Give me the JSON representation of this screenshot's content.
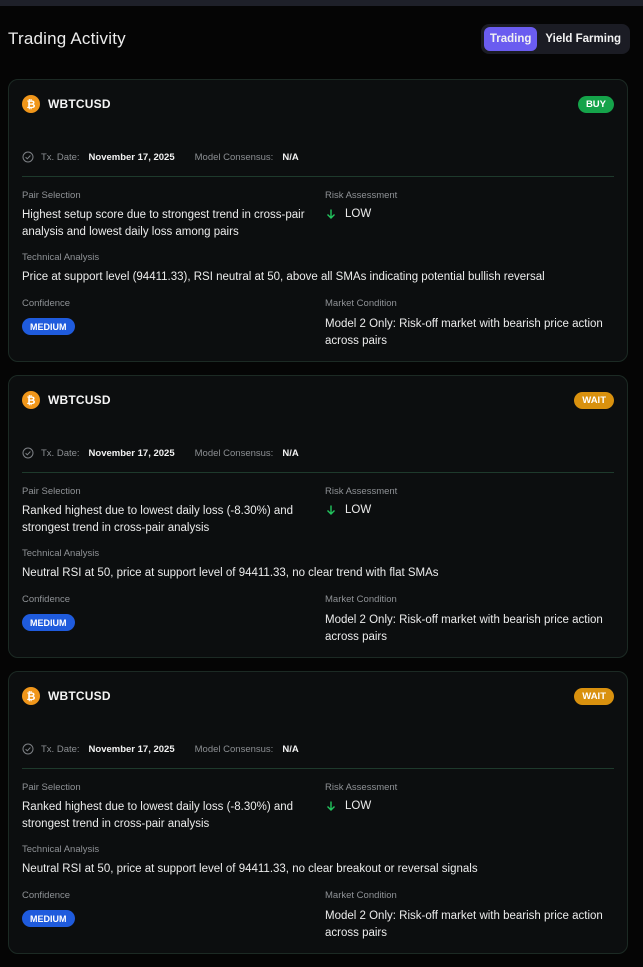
{
  "header": {
    "title": "Trading Activity",
    "tabs": [
      {
        "label": "Trading",
        "active": true
      },
      {
        "label": "Yield Farming",
        "active": false
      }
    ]
  },
  "colors": {
    "accent": "#6a5cf0",
    "buy": "#15a34a",
    "wait": "#d9910e",
    "medium": "#1f5bdd",
    "low_arrow": "#22c55e"
  },
  "cards": [
    {
      "icon": "bitcoin-icon",
      "pair": "WBTCUSD",
      "signal": "BUY",
      "signal_color": "#15a34a",
      "tx_date_label": "Tx. Date:",
      "tx_date": "November 17, 2025",
      "consensus_label": "Model Consensus:",
      "consensus": "N/A",
      "pair_selection_label": "Pair Selection",
      "pair_selection": "Highest setup score due to strongest trend in cross-pair analysis and lowest daily loss among pairs",
      "risk_label": "Risk Assessment",
      "risk": "LOW",
      "technical_label": "Technical Analysis",
      "technical": "Price at support level (94411.33), RSI neutral at 50, above all SMAs indicating potential bullish reversal",
      "confidence_label": "Confidence",
      "confidence": "MEDIUM",
      "market_label": "Market Condition",
      "market": "Model 2 Only: Risk-off market with bearish price action across pairs"
    },
    {
      "icon": "bitcoin-icon",
      "pair": "WBTCUSD",
      "signal": "WAIT",
      "signal_color": "#d9910e",
      "tx_date_label": "Tx. Date:",
      "tx_date": "November 17, 2025",
      "consensus_label": "Model Consensus:",
      "consensus": "N/A",
      "pair_selection_label": "Pair Selection",
      "pair_selection": "Ranked highest due to lowest daily loss (-8.30%) and strongest trend in cross-pair analysis",
      "risk_label": "Risk Assessment",
      "risk": "LOW",
      "technical_label": "Technical Analysis",
      "technical": "Neutral RSI at 50, price at support level of 94411.33, no clear trend with flat SMAs",
      "confidence_label": "Confidence",
      "confidence": "MEDIUM",
      "market_label": "Market Condition",
      "market": "Model 2 Only: Risk-off market with bearish price action across pairs"
    },
    {
      "icon": "bitcoin-icon",
      "pair": "WBTCUSD",
      "signal": "WAIT",
      "signal_color": "#d9910e",
      "tx_date_label": "Tx. Date:",
      "tx_date": "November 17, 2025",
      "consensus_label": "Model Consensus:",
      "consensus": "N/A",
      "pair_selection_label": "Pair Selection",
      "pair_selection": "Ranked highest due to lowest daily loss (-8.30%) and strongest trend in cross-pair analysis",
      "risk_label": "Risk Assessment",
      "risk": "LOW",
      "technical_label": "Technical Analysis",
      "technical": "Neutral RSI at 50, price at support level of 94411.33, no clear breakout or reversal signals",
      "confidence_label": "Confidence",
      "confidence": "MEDIUM",
      "market_label": "Market Condition",
      "market": "Model 2 Only: Risk-off market with bearish price action across pairs"
    }
  ]
}
